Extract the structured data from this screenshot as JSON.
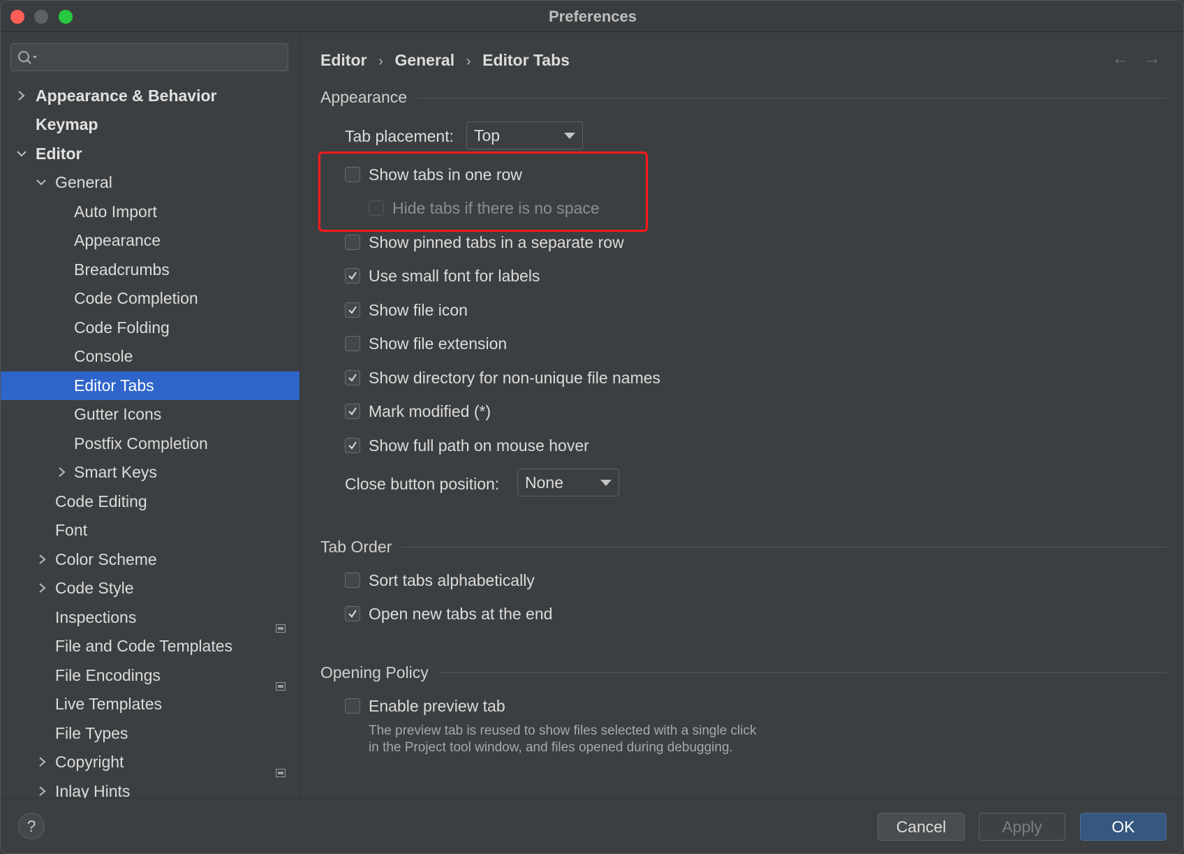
{
  "window": {
    "title": "Preferences"
  },
  "search": {
    "placeholder": ""
  },
  "sidebar": {
    "items": [
      {
        "label": "Appearance & Behavior"
      },
      {
        "label": "Keymap"
      },
      {
        "label": "Editor"
      },
      {
        "label": "General"
      },
      {
        "label": "Auto Import"
      },
      {
        "label": "Appearance"
      },
      {
        "label": "Breadcrumbs"
      },
      {
        "label": "Code Completion"
      },
      {
        "label": "Code Folding"
      },
      {
        "label": "Console"
      },
      {
        "label": "Editor Tabs"
      },
      {
        "label": "Gutter Icons"
      },
      {
        "label": "Postfix Completion"
      },
      {
        "label": "Smart Keys"
      },
      {
        "label": "Code Editing"
      },
      {
        "label": "Font"
      },
      {
        "label": "Color Scheme"
      },
      {
        "label": "Code Style"
      },
      {
        "label": "Inspections"
      },
      {
        "label": "File and Code Templates"
      },
      {
        "label": "File Encodings"
      },
      {
        "label": "Live Templates"
      },
      {
        "label": "File Types"
      },
      {
        "label": "Copyright"
      },
      {
        "label": "Inlay Hints"
      }
    ],
    "selected": "Editor Tabs"
  },
  "breadcrumb": {
    "items": [
      "Editor",
      "General",
      "Editor Tabs"
    ],
    "separator": "›"
  },
  "nav": {
    "back": "←",
    "forward": "→"
  },
  "appearance": {
    "title": "Appearance",
    "tab_placement_label": "Tab placement:",
    "tab_placement_value": "Top",
    "options": [
      {
        "label": "Show tabs in one row",
        "checked": false
      },
      {
        "label": "Hide tabs if there is no space",
        "checked": false,
        "disabled": true
      },
      {
        "label": "Show pinned tabs in a separate row",
        "checked": false
      },
      {
        "label": "Use small font for labels",
        "checked": true
      },
      {
        "label": "Show file icon",
        "checked": true
      },
      {
        "label": "Show file extension",
        "checked": false
      },
      {
        "label": "Show directory for non-unique file names",
        "checked": true
      },
      {
        "label": "Mark modified (*)",
        "checked": true
      },
      {
        "label": "Show full path on mouse hover",
        "checked": true
      }
    ],
    "close_button_label": "Close button position:",
    "close_button_value": "None"
  },
  "tab_order": {
    "title": "Tab Order",
    "options": [
      {
        "label": "Sort tabs alphabetically",
        "checked": false
      },
      {
        "label": "Open new tabs at the end",
        "checked": true
      }
    ]
  },
  "opening_policy": {
    "title": "Opening Policy",
    "options": [
      {
        "label": "Enable preview tab",
        "checked": false
      }
    ],
    "help": "The preview tab is reused to show files selected with a single click in the Project tool window, and files opened during debugging."
  },
  "footer": {
    "help": "?",
    "cancel": "Cancel",
    "apply": "Apply",
    "ok": "OK"
  },
  "colors": {
    "accent": "#2f65ca",
    "highlight": "#ff1a1a",
    "background": "#3c3f41"
  }
}
